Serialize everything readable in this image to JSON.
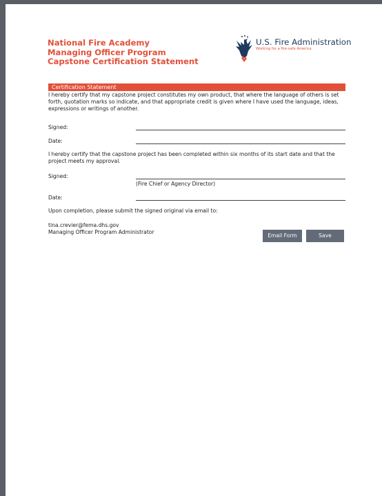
{
  "header": {
    "line1": "National Fire Academy",
    "line2": "Managing Officer Program",
    "line3": "Capstone Certification Statement"
  },
  "logo": {
    "name": "U.S. Fire Administration",
    "tagline": "Working for a fire-safe America",
    "icon": "eagle-icon"
  },
  "section_bar": "Certification Statement",
  "para1": "I hereby certify that my capstone project constitutes my own product, that where the language of others is set forth, quotation marks so indicate, and that appropriate credit is given where I have used the language, ideas, expressions or writings of another.",
  "signed_label_1": "Signed:",
  "date_label_1": "Date:",
  "para2": "I hereby certify that the capstone project has been completed within six months of its start date and that the project meets my approval.",
  "signed_label_2": "Signed:",
  "signer_caption": "(Fire Chief or Agency Director)",
  "date_label_2": "Date:",
  "submit_text": "Upon completion, please submit the signed original via email to:",
  "contact_email": "tina.crevier@fema.dhs.gov",
  "contact_title": "Managing Officer Program Administrator",
  "buttons": {
    "email_form": "Email Form",
    "save": "Save"
  },
  "colors": {
    "accent": "#e2503a",
    "brand_blue": "#1f3a5f",
    "button": "#626b77",
    "frame": "#5a5f66"
  }
}
